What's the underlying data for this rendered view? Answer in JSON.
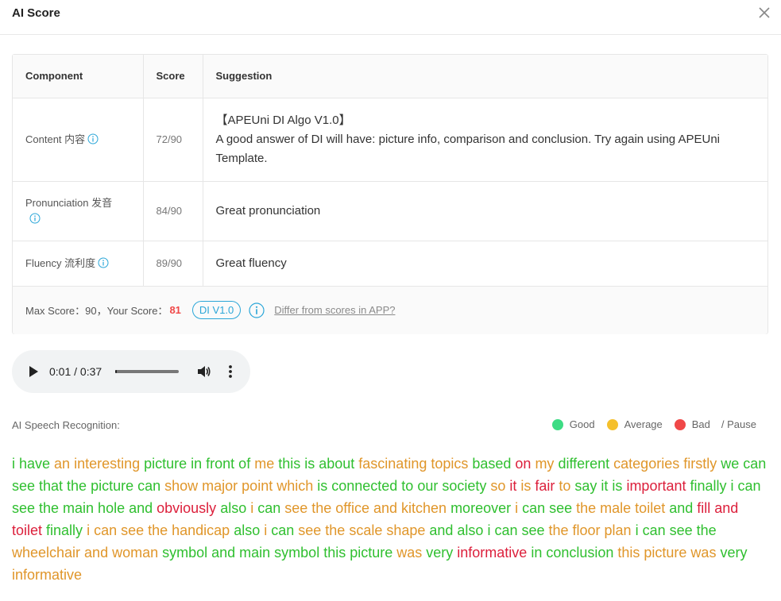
{
  "header": {
    "title": "AI Score"
  },
  "table": {
    "headers": [
      "Component",
      "Score",
      "Suggestion"
    ],
    "rows": [
      {
        "component": "Content 内容",
        "score": "72/90",
        "suggestion_line1": "【APEUni DI Algo V1.0】",
        "suggestion_line2": "A good answer of DI will have: picture info, comparison and conclusion. Try again using APEUni Template."
      },
      {
        "component": "Pronunciation 发音",
        "score": "84/90",
        "suggestion": "Great pronunciation"
      },
      {
        "component": "Fluency 流利度",
        "score": "89/90",
        "suggestion": "Great fluency"
      }
    ],
    "footer": {
      "max_score_text": "Max Score：90，Your Score：",
      "your_score": "81",
      "version_badge": "DI V1.0",
      "differ_link": "Differ from scores in APP?"
    }
  },
  "audio": {
    "time": "0:01 / 0:37",
    "progress": 0.03
  },
  "asr": {
    "label": "AI Speech Recognition:"
  },
  "legend": {
    "good": "Good",
    "average": "Average",
    "bad": "Bad",
    "pause": "/  Pause",
    "colors": {
      "good": "#3ddc84",
      "average": "#f5c02c",
      "bad": "#f04848"
    }
  },
  "transcript": [
    {
      "t": "i have",
      "c": "good"
    },
    {
      "t": " an interesting",
      "c": "avg"
    },
    {
      "t": " picture in front of",
      "c": "good"
    },
    {
      "t": " me",
      "c": "avg"
    },
    {
      "t": " this",
      "c": "good"
    },
    {
      "t": " is about",
      "c": "good"
    },
    {
      "t": " fascinating topics",
      "c": "avg"
    },
    {
      "t": " based",
      "c": "good"
    },
    {
      "t": " on",
      "c": "bad"
    },
    {
      "t": " my",
      "c": "avg"
    },
    {
      "t": " different",
      "c": "good"
    },
    {
      "t": " categories",
      "c": "avg"
    },
    {
      "t": " firstly",
      "c": "avg"
    },
    {
      "t": " we can see that the",
      "c": "good"
    },
    {
      "t": " picture can",
      "c": "good"
    },
    {
      "t": " show major point which",
      "c": "avg"
    },
    {
      "t": " is connected to our society",
      "c": "good"
    },
    {
      "t": " so",
      "c": "avg"
    },
    {
      "t": " it",
      "c": "bad"
    },
    {
      "t": " is",
      "c": "avg"
    },
    {
      "t": " fair",
      "c": "bad"
    },
    {
      "t": " to",
      "c": "avg"
    },
    {
      "t": " say it is",
      "c": "good"
    },
    {
      "t": " important",
      "c": "bad"
    },
    {
      "t": " finally i can see the main hole and",
      "c": "good"
    },
    {
      "t": " obviously",
      "c": "bad"
    },
    {
      "t": " also",
      "c": "good"
    },
    {
      "t": " i",
      "c": "avg"
    },
    {
      "t": " can",
      "c": "good"
    },
    {
      "t": " see the office and kitchen",
      "c": "avg"
    },
    {
      "t": " moreover",
      "c": "good"
    },
    {
      "t": " i",
      "c": "avg"
    },
    {
      "t": " can see",
      "c": "good"
    },
    {
      "t": " the male toilet",
      "c": "avg"
    },
    {
      "t": " and",
      "c": "good"
    },
    {
      "t": " fill and toilet",
      "c": "bad"
    },
    {
      "t": " finally",
      "c": "good"
    },
    {
      "t": " i",
      "c": "avg"
    },
    {
      "t": " can see the handicap",
      "c": "avg"
    },
    {
      "t": " also",
      "c": "good"
    },
    {
      "t": " i",
      "c": "avg"
    },
    {
      "t": " can",
      "c": "good"
    },
    {
      "t": " see the scale shape",
      "c": "avg"
    },
    {
      "t": " and also",
      "c": "good"
    },
    {
      "t": " i can see",
      "c": "good"
    },
    {
      "t": " the floor plan",
      "c": "avg"
    },
    {
      "t": " i can see the",
      "c": "good"
    },
    {
      "t": " wheelchair and woman",
      "c": "avg"
    },
    {
      "t": " symbol and main symbol this picture",
      "c": "good"
    },
    {
      "t": " was",
      "c": "avg"
    },
    {
      "t": " very",
      "c": "good"
    },
    {
      "t": " informative",
      "c": "bad"
    },
    {
      "t": " in",
      "c": "good"
    },
    {
      "t": " conclusion",
      "c": "good"
    },
    {
      "t": " this picture was",
      "c": "avg"
    },
    {
      "t": " very",
      "c": "good"
    },
    {
      "t": " informative",
      "c": "avg"
    }
  ]
}
